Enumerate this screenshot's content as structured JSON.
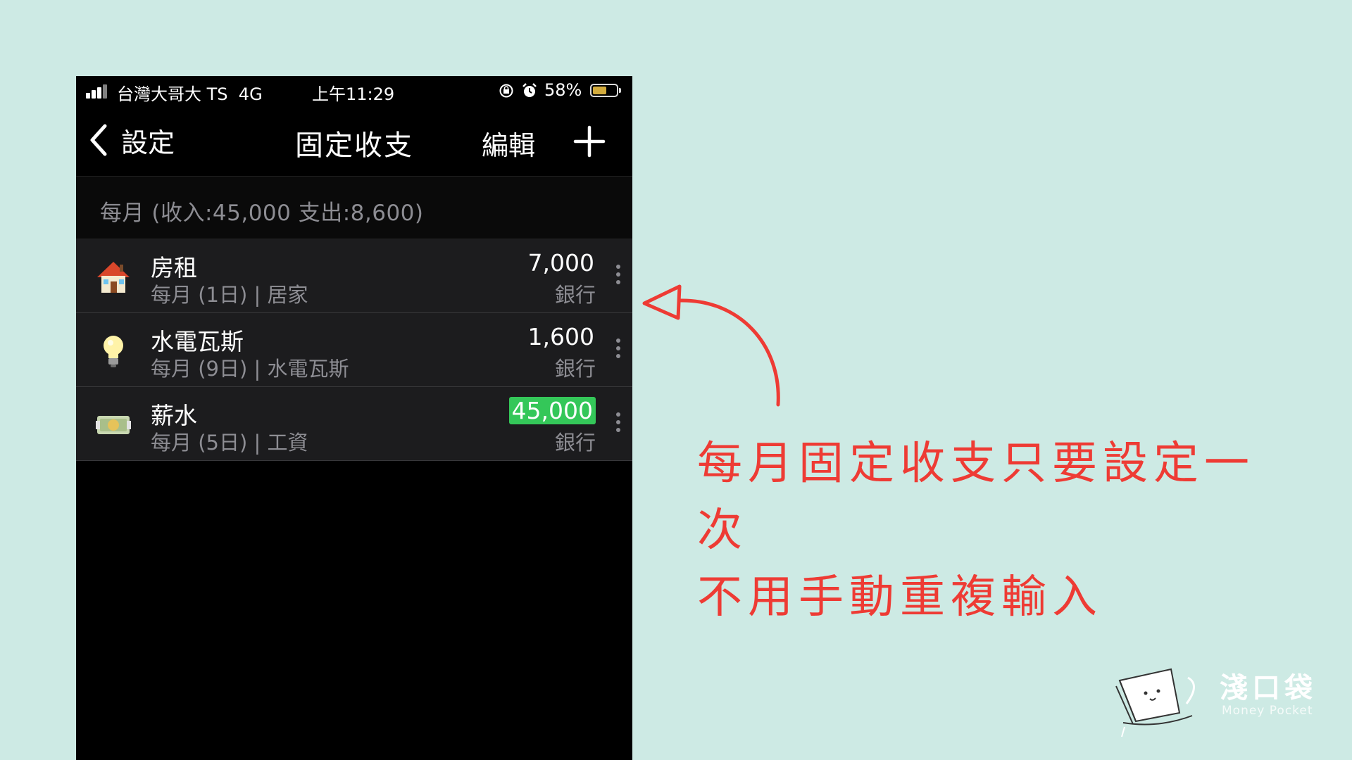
{
  "status_bar": {
    "carrier": "台灣大哥大 TS",
    "network": "4G",
    "time": "上午11:29",
    "battery_percent": "58%",
    "battery_level": 0.58,
    "icons": [
      "signal-icon",
      "rotation-lock-icon",
      "alarm-icon",
      "battery-icon"
    ]
  },
  "nav": {
    "back_label": "設定",
    "title": "固定收支",
    "edit_label": "編輯",
    "add_icon": "plus-icon"
  },
  "summary": {
    "text": "每月 (收入:45,000  支出:8,600)"
  },
  "items": [
    {
      "icon": "house-icon",
      "name": "房租",
      "schedule": "每月 (1日) | 居家",
      "amount": "7,000",
      "account": "銀行",
      "type": "expense"
    },
    {
      "icon": "light-bulb-icon",
      "name": "水電瓦斯",
      "schedule": "每月 (9日) | 水電瓦斯",
      "amount": "1,600",
      "account": "銀行",
      "type": "expense"
    },
    {
      "icon": "money-bill-icon",
      "name": "薪水",
      "schedule": "每月 (5日) | 工資",
      "amount": "45,000",
      "account": "銀行",
      "type": "income"
    }
  ],
  "annotation": {
    "line1": "每月固定收支只要設定一次",
    "line2": "不用手動重複輸入",
    "color": "#ee3b34"
  },
  "logo": {
    "name": "淺口袋",
    "sub": "Money Pocket"
  },
  "colors": {
    "background": "#cdeae4",
    "income_highlight": "#34c759",
    "battery": "#f7c948"
  }
}
